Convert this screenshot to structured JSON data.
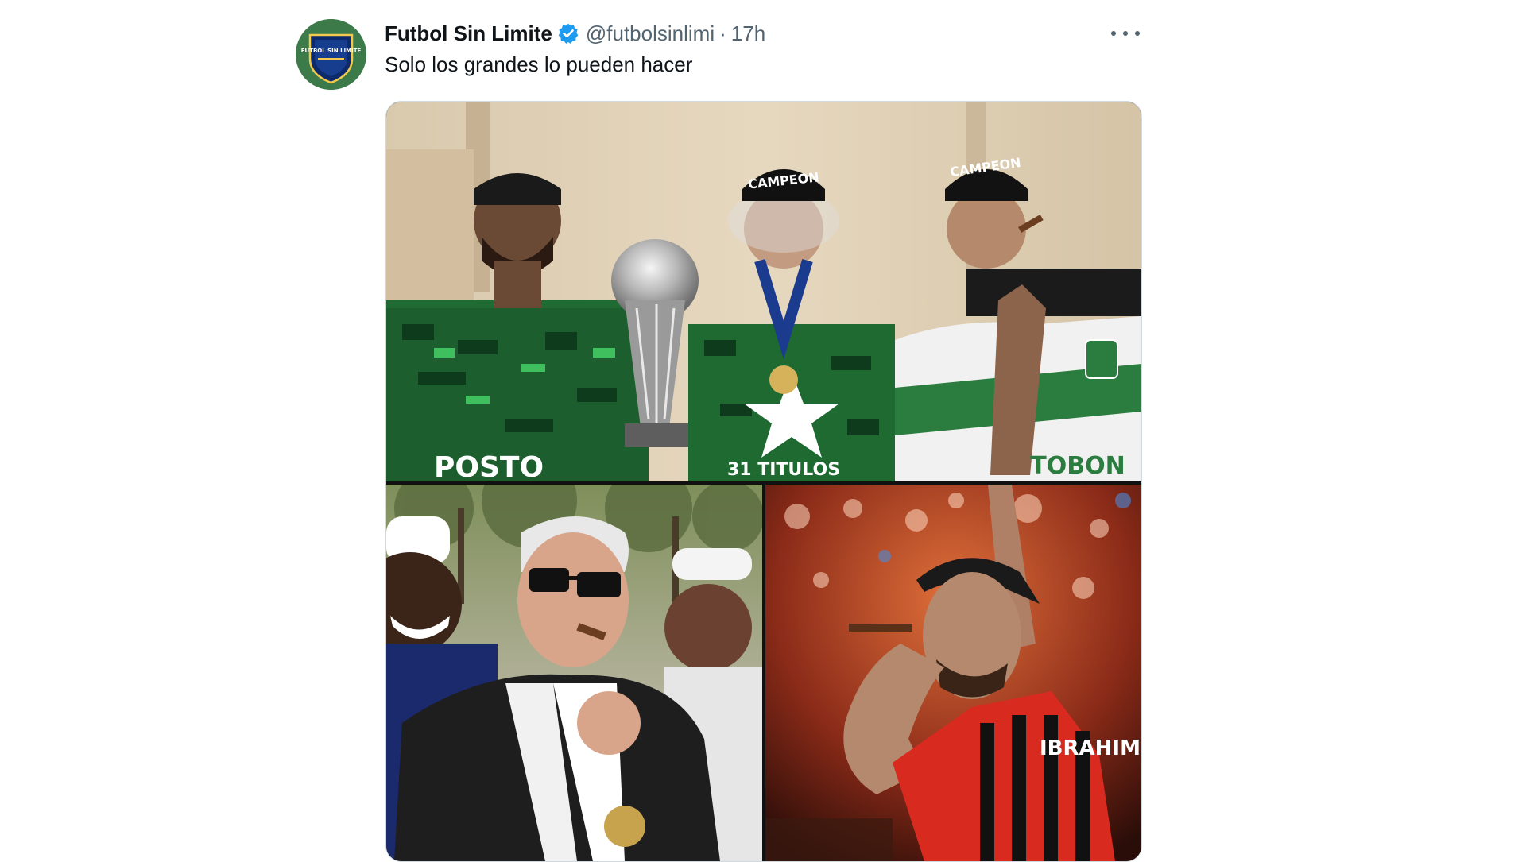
{
  "tweet": {
    "author_name": "Futbol Sin Limite",
    "handle": "@futbolsinlimi",
    "separator": "·",
    "time": "17h",
    "text": "Solo los grandes lo pueden hacer",
    "verified": true,
    "avatar_text": "FUTBOL SIN LIMITE",
    "accent_color": "#1d9bf0"
  },
  "media": {
    "photos": [
      {
        "name": "photo-team-celebration",
        "cap_text": "CAMPEON",
        "shirt_text_left": "POSTO",
        "shirt_text_right": "TOBON",
        "shirt_text_center": "31 TITULOS"
      },
      {
        "name": "photo-coach-cigar"
      },
      {
        "name": "photo-player-cigar",
        "shirt_text": "IBRAHIM"
      }
    ]
  },
  "icons": {
    "verified": "verified-badge-icon",
    "more": "more-options-icon"
  }
}
